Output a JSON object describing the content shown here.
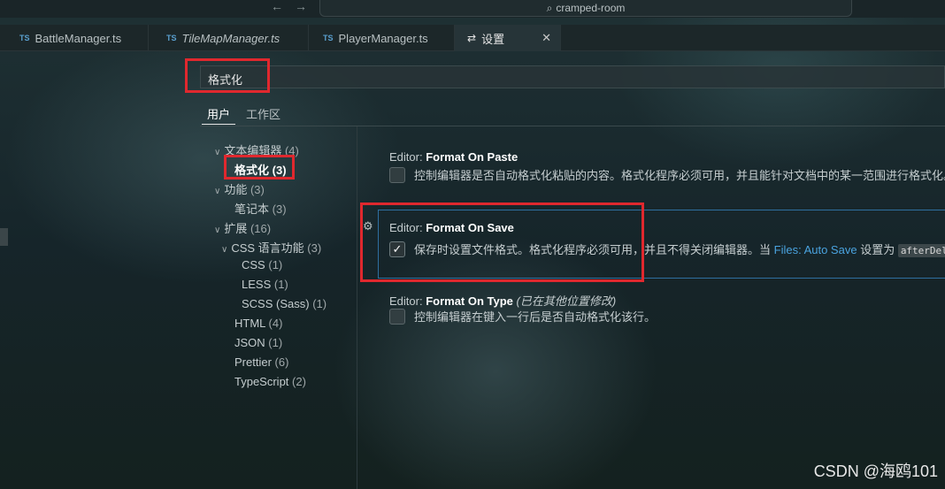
{
  "titlebar": {
    "back_arrow": "←",
    "forward_arrow": "→",
    "search_icon": "⌕",
    "project": "cramped-room"
  },
  "tabs": [
    {
      "type_badge": "TS",
      "label": "BattleManager.ts"
    },
    {
      "type_badge": "TS",
      "label": "TileMapManager.ts"
    },
    {
      "type_badge": "TS",
      "label": "PlayerManager.ts"
    },
    {
      "icon": "settings-sliders-icon",
      "label": "设置",
      "close": "✕"
    }
  ],
  "settings_search": {
    "value": "格式化"
  },
  "scope_tabs": {
    "user": "用户",
    "workspace": "工作区"
  },
  "tree": [
    {
      "label": "文本编辑器",
      "count": "(4)",
      "expanded": true
    },
    {
      "label": "格式化",
      "count": "(3)",
      "selected": true
    },
    {
      "label": "功能",
      "count": "(3)",
      "expanded": true
    },
    {
      "label": "笔记本",
      "count": "(3)"
    },
    {
      "label": "扩展",
      "count": "(16)",
      "expanded": true
    },
    {
      "label": "CSS 语言功能",
      "count": "(3)",
      "expanded": true
    },
    {
      "label": "CSS",
      "count": "(1)"
    },
    {
      "label": "LESS",
      "count": "(1)"
    },
    {
      "label": "SCSS (Sass)",
      "count": "(1)"
    },
    {
      "label": "HTML",
      "count": "(4)"
    },
    {
      "label": "JSON",
      "count": "(1)"
    },
    {
      "label": "Prettier",
      "count": "(6)"
    },
    {
      "label": "TypeScript",
      "count": "(2)"
    }
  ],
  "settings": [
    {
      "prefix": "Editor: ",
      "name": "Format On Paste",
      "checked": false,
      "description": "控制编辑器是否自动格式化粘贴的内容。格式化程序必须可用，并且能针对文档中的某一范围进行格式化。"
    },
    {
      "prefix": "Editor: ",
      "name": "Format On Save",
      "checked": true,
      "check_mark": "✓",
      "gear": "⚙",
      "description": "保存时设置文件格式。格式化程序必须可用，并且不得关闭编辑器。当 ",
      "link": "Files: Auto Save",
      "description_after": " 设置为 ",
      "code": "afterDelay"
    },
    {
      "prefix": "Editor: ",
      "name": "Format On Type",
      "note": "(已在其他位置修改)",
      "checked": false,
      "description": "控制编辑器在键入一行后是否自动格式化该行。"
    }
  ],
  "watermark": "CSDN @海鸥101",
  "colors": {
    "annotation_red": "#e0282e",
    "link": "#4aa3df",
    "focus": "#2f6fa0"
  }
}
